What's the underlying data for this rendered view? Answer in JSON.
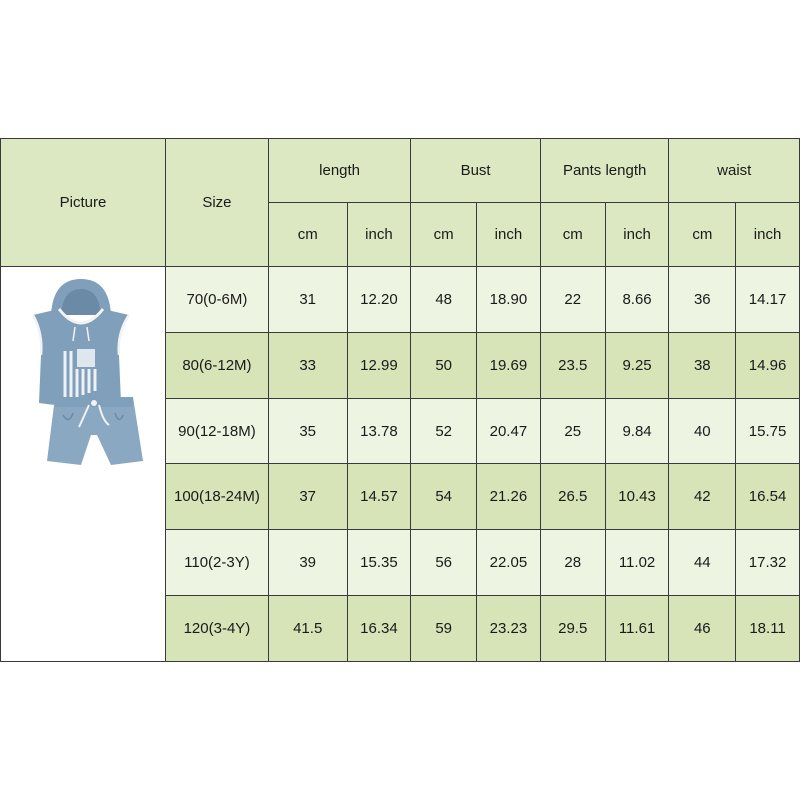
{
  "headers": {
    "picture": "Picture",
    "size": "Size",
    "groups": [
      "length",
      "Bust",
      "Pants length",
      "waist"
    ],
    "units": [
      "cm",
      "inch",
      "cm",
      "inch",
      "cm",
      "inch",
      "cm",
      "inch"
    ]
  },
  "rows": [
    {
      "size": "70(0-6M)",
      "values": [
        "31",
        "12.20",
        "48",
        "18.90",
        "22",
        "8.66",
        "36",
        "14.17"
      ]
    },
    {
      "size": "80(6-12M)",
      "values": [
        "33",
        "12.99",
        "50",
        "19.69",
        "23.5",
        "9.25",
        "38",
        "14.96"
      ]
    },
    {
      "size": "90(12-18M)",
      "values": [
        "35",
        "13.78",
        "52",
        "20.47",
        "25",
        "9.84",
        "40",
        "15.75"
      ]
    },
    {
      "size": "100(18-24M)",
      "values": [
        "37",
        "14.57",
        "54",
        "21.26",
        "26.5",
        "10.43",
        "42",
        "16.54"
      ]
    },
    {
      "size": "110(2-3Y)",
      "values": [
        "39",
        "15.35",
        "56",
        "22.05",
        "28",
        "11.02",
        "44",
        "17.32"
      ]
    },
    {
      "size": "120(3-4Y)",
      "values": [
        "41.5",
        "16.34",
        "59",
        "23.23",
        "29.5",
        "11.61",
        "46",
        "18.11"
      ]
    }
  ],
  "colors": {
    "header_bg": "#dce8c2",
    "row_light": "#eef4e2",
    "row_dark": "#d6e4b8",
    "product_blue": "#7f9fba"
  },
  "product_image": "blue-hooded-tank-and-shorts-set"
}
